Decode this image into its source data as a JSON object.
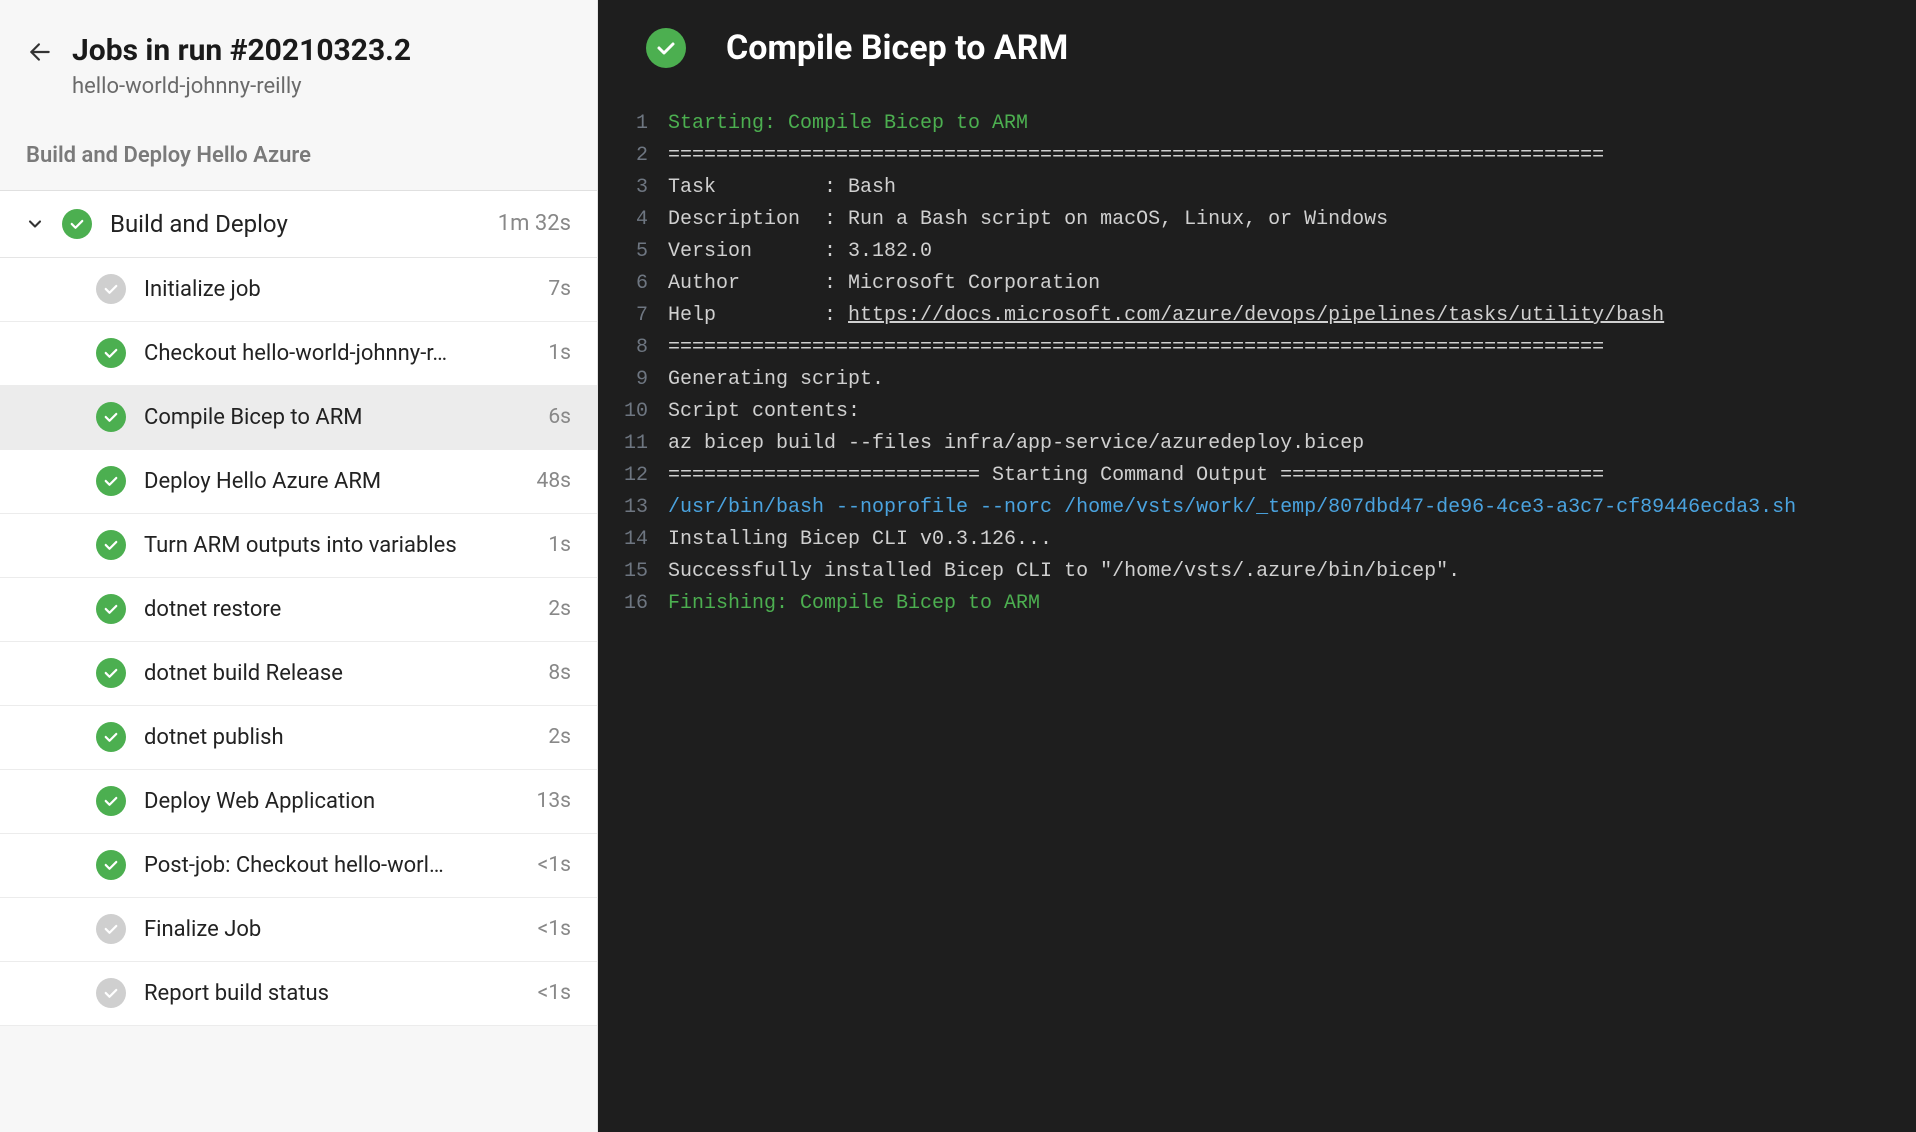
{
  "header": {
    "title": "Jobs in run #20210323.2",
    "subtitle": "hello-world-johnny-reilly"
  },
  "section": {
    "title": "Build and Deploy Hello Azure"
  },
  "job": {
    "label": "Build and Deploy",
    "duration": "1m 32s",
    "status": "success",
    "expanded": true
  },
  "steps": [
    {
      "label": "Initialize job",
      "duration": "7s",
      "status": "neutral",
      "selected": false
    },
    {
      "label": "Checkout hello-world-johnny-r…",
      "duration": "1s",
      "status": "success",
      "selected": false
    },
    {
      "label": "Compile Bicep to ARM",
      "duration": "6s",
      "status": "success",
      "selected": true
    },
    {
      "label": "Deploy Hello Azure ARM",
      "duration": "48s",
      "status": "success",
      "selected": false
    },
    {
      "label": "Turn ARM outputs into variables",
      "duration": "1s",
      "status": "success",
      "selected": false
    },
    {
      "label": "dotnet restore",
      "duration": "2s",
      "status": "success",
      "selected": false
    },
    {
      "label": "dotnet build Release",
      "duration": "8s",
      "status": "success",
      "selected": false
    },
    {
      "label": "dotnet publish",
      "duration": "2s",
      "status": "success",
      "selected": false
    },
    {
      "label": "Deploy Web Application",
      "duration": "13s",
      "status": "success",
      "selected": false
    },
    {
      "label": "Post-job: Checkout hello-worl…",
      "duration": "<1s",
      "status": "success",
      "selected": false
    },
    {
      "label": "Finalize Job",
      "duration": "<1s",
      "status": "neutral",
      "selected": false
    },
    {
      "label": "Report build status",
      "duration": "<1s",
      "status": "neutral",
      "selected": false
    }
  ],
  "log": {
    "title": "Compile Bicep to ARM",
    "status": "success",
    "lines": [
      {
        "n": 1,
        "text": "Starting: Compile Bicep to ARM",
        "cls": "green"
      },
      {
        "n": 2,
        "text": "==============================================================================",
        "cls": ""
      },
      {
        "n": 3,
        "text": "Task         : Bash",
        "cls": ""
      },
      {
        "n": 4,
        "text": "Description  : Run a Bash script on macOS, Linux, or Windows",
        "cls": ""
      },
      {
        "n": 5,
        "text": "Version      : 3.182.0",
        "cls": ""
      },
      {
        "n": 6,
        "text": "Author       : Microsoft Corporation",
        "cls": ""
      },
      {
        "n": 7,
        "text": "Help         : ",
        "link": "https://docs.microsoft.com/azure/devops/pipelines/tasks/utility/bash",
        "cls": ""
      },
      {
        "n": 8,
        "text": "==============================================================================",
        "cls": ""
      },
      {
        "n": 9,
        "text": "Generating script.",
        "cls": ""
      },
      {
        "n": 10,
        "text": "Script contents:",
        "cls": ""
      },
      {
        "n": 11,
        "text": "az bicep build --files infra/app-service/azuredeploy.bicep",
        "cls": ""
      },
      {
        "n": 12,
        "text": "========================== Starting Command Output ===========================",
        "cls": ""
      },
      {
        "n": 13,
        "text": "/usr/bin/bash --noprofile --norc /home/vsts/work/_temp/807dbd47-de96-4ce3-a3c7-cf89446ecda3.sh",
        "cls": "blue"
      },
      {
        "n": 14,
        "text": "Installing Bicep CLI v0.3.126...",
        "cls": ""
      },
      {
        "n": 15,
        "text": "Successfully installed Bicep CLI to \"/home/vsts/.azure/bin/bicep\".",
        "cls": ""
      },
      {
        "n": 16,
        "text": "Finishing: Compile Bicep to ARM",
        "cls": "green"
      }
    ]
  }
}
